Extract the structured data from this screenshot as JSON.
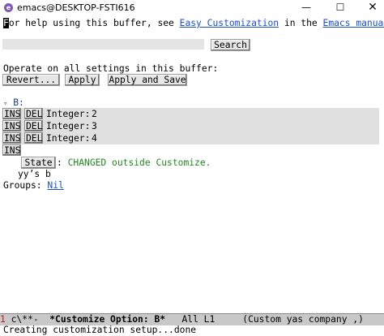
{
  "window": {
    "title": "emacs@DESKTOP-FSTI616",
    "icon": "emacs-icon",
    "controls": {
      "minimize": "—",
      "maximize": "☐",
      "close": "✕"
    }
  },
  "help_line": {
    "cursor_char": "F",
    "prefix": "or help using this buffer, see ",
    "link1": "Easy Customization",
    "middle": " in the ",
    "link2": "Emacs manual",
    "suffix": "."
  },
  "search": {
    "value": "",
    "button": "Search"
  },
  "operate": {
    "label": "Operate on all settings in this buffer:",
    "revert": "Revert...",
    "apply": "Apply",
    "apply_save": "Apply and Save"
  },
  "option": {
    "triangle": "▿",
    "name": "B:",
    "ins_label": "INS",
    "del_label": "DEL",
    "items": [
      {
        "type": "Integer:",
        "value": "2"
      },
      {
        "type": "Integer:",
        "value": "3"
      },
      {
        "type": "Integer:",
        "value": "4"
      }
    ],
    "state_button": "State",
    "state_sep": ":",
    "state_text": "CHANGED outside Customize.",
    "doc": "yy’s b",
    "groups_label": "Groups:",
    "groups_link": "Nil"
  },
  "modeline": {
    "indicator": "1",
    "flags": " c\\**-  ",
    "buffer": "*Customize Option: B*",
    "position": "   All L1     ",
    "mode": "(Custom yas company ,)"
  },
  "echo_area": "Creating customization setup...done",
  "colors": {
    "link": "#1a4fd0",
    "changed": "#228822",
    "modeline_bg": "#c8c8c8",
    "row_bg": "#e0e0e0"
  }
}
